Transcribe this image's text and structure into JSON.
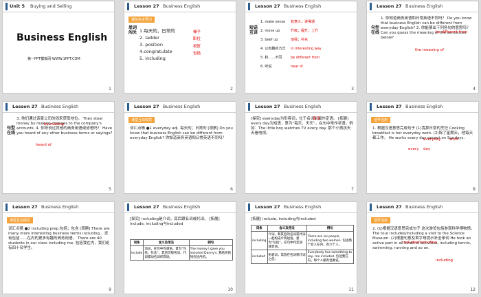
{
  "slides": [
    {
      "n": "1",
      "unit": "Unit 5",
      "unit_title": "Buying and Selling",
      "title": "Business English",
      "sub": "第一PPT模板网-WWW.1PPT.COM"
    },
    {
      "n": "2",
      "lesson": "Lesson 27",
      "topic": "Business English",
      "badge": "课前自主预习",
      "side": "单词闯关",
      "items": [
        "1.每天的，日常的",
        "2. ladder",
        "3. position",
        "4.congratulate",
        "5. including"
      ],
      "red": [
        "日常的",
        "梯子",
        "职位",
        "祝贺",
        "包括"
      ]
    },
    {
      "n": "3",
      "lesson": "Lesson 27",
      "topic": "Business English",
      "side": "短语互译",
      "items": [
        "1. make sense",
        "2. move up",
        "3. beef up",
        "4. 以有趣的方式",
        "5. 和……不同",
        "6. 听说"
      ],
      "red": [
        "有意义；讲得通",
        "升级；提升；上升",
        "加强；补充",
        "in interesting way",
        "be different from",
        "hear of"
      ]
    },
    {
      "n": "4",
      "lesson": "Lesson 27",
      "topic": "Business English",
      "side": "句型在线",
      "text": "1. 你知道商务英语和日常英语不同吗？ Do you know that business English can be different from everyday English?  2. 你能猜出下列各句的意思吗？ Can you guess the meaning of the sentences below?",
      "red": [
        "be different from",
        "the meaning of"
      ]
    },
    {
      "n": "5",
      "lesson": "Lesson 27",
      "topic": "Business English",
      "side": "句型在线",
      "text": "3. 他们通过该家公司的钱来获取地位。 They steal money by making changes to the company's accounts.  4. 你听说过其他的商务用语或谚语吗？ Have you heard of any other business terms or sayings?",
      "red": [
        "by making",
        "heard of"
      ]
    },
    {
      "n": "6",
      "lesson": "Lesson 27",
      "topic": "Business English",
      "badge": "课堂互动探究",
      "text": "词汇点睛 ●1 everyday adj. 每天的；日常的  [观察] Do you know that business English can be different from everyday English? 你知道商务英语和日常英语不同吗？"
    },
    {
      "n": "7",
      "lesson": "Lesson 27",
      "topic": "Business English",
      "text": "[探究] everyday为形容词，位于名词前面作定语。 [拓展] every day为短语，意为“每天，天天”，在句中常作状语。例如：The little boy watches TV every day. 那个小男孩天天看电视。",
      "red": [
        "名词"
      ]
    },
    {
      "n": "8",
      "lesson": "Lesson 27",
      "topic": "Business English",
      "badge": "活学活用",
      "text": "1. 根据汉语意思完成句子 (1)我那日常的烹饪 Cooking breakfast is her everyday work. (2)除了星期天，他每天都工作。 He works every day except on Sundays.",
      "red": [
        "everyday",
        "work",
        "every",
        "day"
      ]
    },
    {
      "n": "9",
      "lesson": "Lesson 27",
      "topic": "Business English",
      "badge": "课堂互动探究",
      "text": "词汇点睛 ●2 including prep.包括；包含  [观察] There are many more interesting business terms including... 还有包括……在内的更多有趣的商务用语。 There are 40 students in our class including me. 包括我在内，我们班有四十名学生。"
    },
    {
      "n": "10",
      "lesson": "Lesson 27",
      "topic": "Business English",
      "text": "[探究] including是介词，其后跟名词或代词。 [拓展] include, including与included",
      "table": [
        "词条",
        "含义及用法",
        "例句",
        "include",
        "动词，在句中作谓语，意为“包括、包含”，其后可接名词、代词或动名词作宾语。",
        "The money I gave you included Danny's. 我给你的钱包括丹的。"
      ]
    },
    {
      "n": "11",
      "lesson": "Lesson 27",
      "topic": "Business English",
      "text": "[拓展] include, including与included",
      "table": [
        "词条",
        "含义及用法",
        "例句",
        "including",
        "介词，和其后的名词或代词一起构成介宾短语，意为“包括”，在句中作定语或状语。",
        "There are six people, including two women. 包括两个女人在内，有六个人。",
        "included",
        "形容词，常放在名词或代词之后。",
        "Everybody has something to say, me included. 包括我在内，每个人都有话要说。"
      ]
    },
    {
      "n": "12",
      "lesson": "Lesson 27",
      "topic": "Business English",
      "badge": "活学活用",
      "text": "2. (1)根据汉语意思完成句子 这次游览包括参观科学博物馆。 The tour includes/including a visit to the Science Museum. (2)根据句意及首字母提示补全单词 He took an active part in all kinds of activities, including tennis, swimming, running and so on.",
      "red": [
        "includes/including",
        "including"
      ]
    }
  ]
}
